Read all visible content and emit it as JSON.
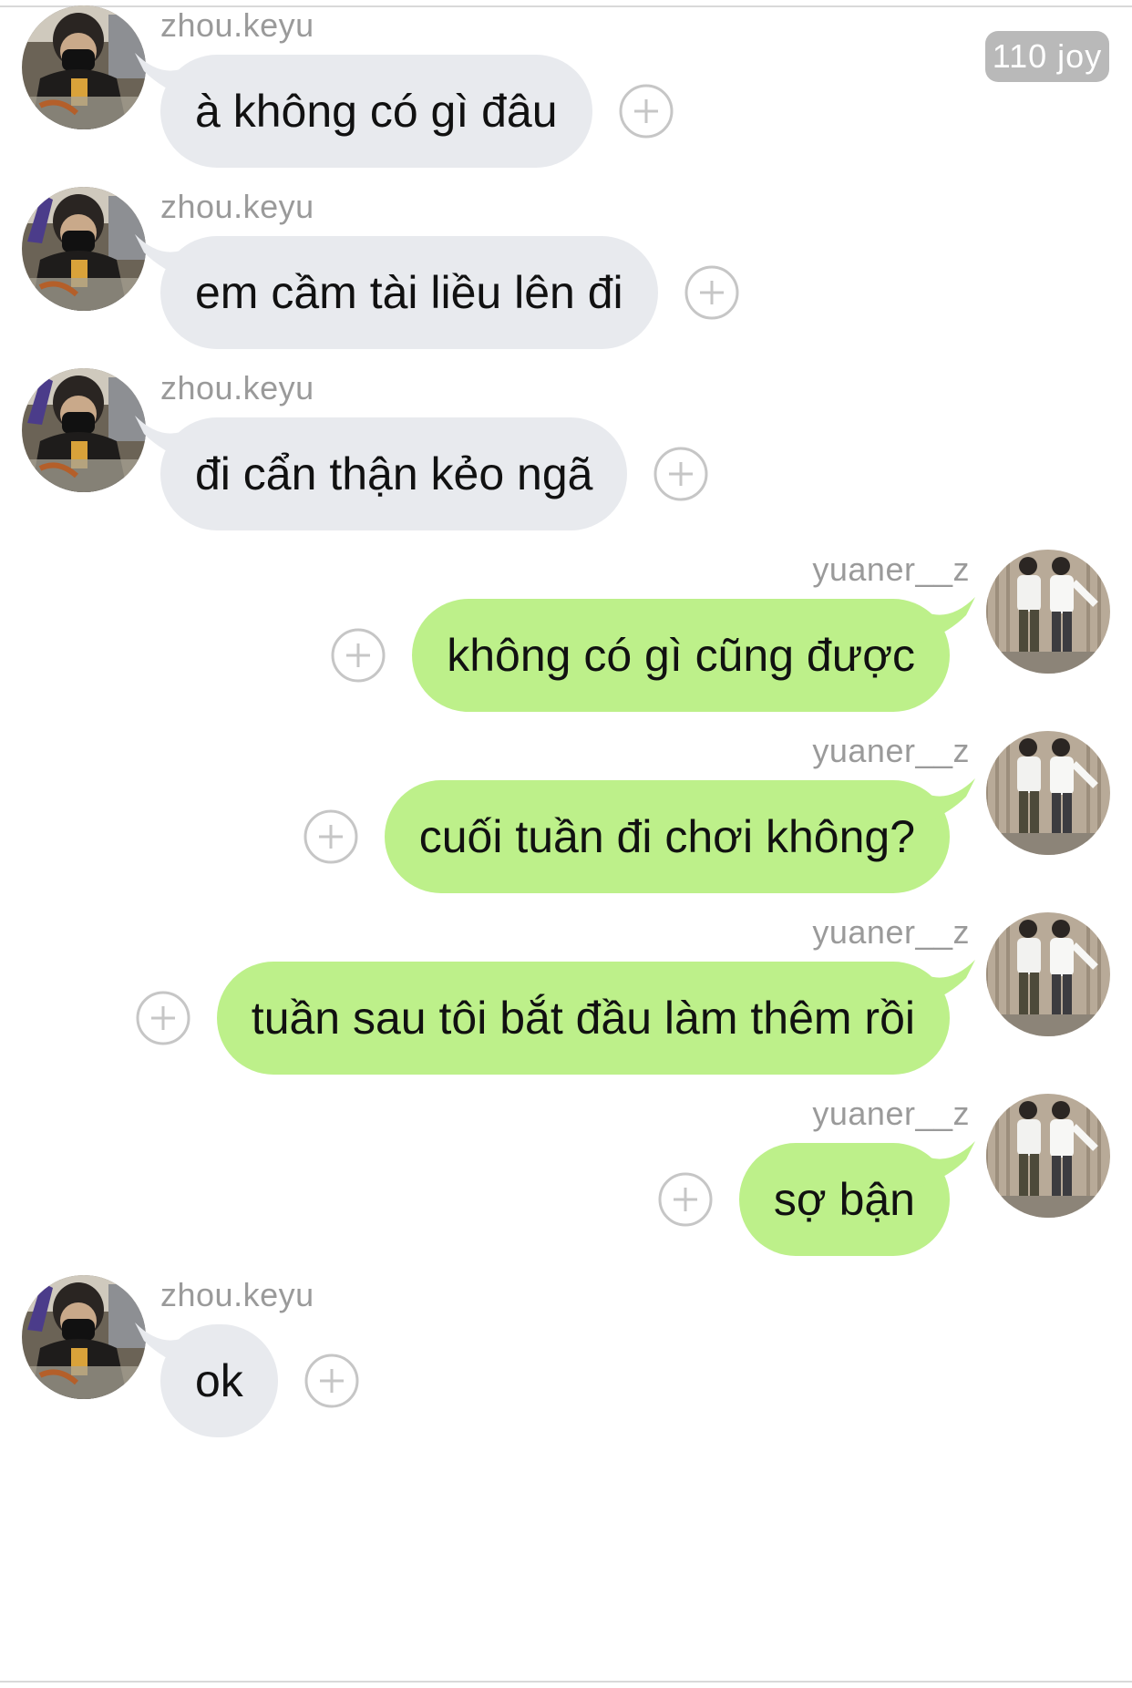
{
  "badge": "110 joy",
  "colors": {
    "incoming_bubble": "#e8eaee",
    "outgoing_bubble": "#bdf08a",
    "sender_text": "#9a9a9a",
    "badge_bg": "#b9b9b9"
  },
  "icons": {
    "add_reaction": "plus-circle-icon"
  },
  "messages": [
    {
      "direction": "in",
      "sender": "zhou.keyu",
      "text": "à không có gì đâu"
    },
    {
      "direction": "in",
      "sender": "zhou.keyu",
      "text": "em cầm tài liều lên đi"
    },
    {
      "direction": "in",
      "sender": "zhou.keyu",
      "text": "đi cẩn thận kẻo ngã"
    },
    {
      "direction": "out",
      "sender": "yuaner__z",
      "text": "không có gì cũng được"
    },
    {
      "direction": "out",
      "sender": "yuaner__z",
      "text": "cuối tuần đi chơi không?"
    },
    {
      "direction": "out",
      "sender": "yuaner__z",
      "text": "tuần sau tôi bắt đầu làm thêm rồi"
    },
    {
      "direction": "out",
      "sender": "yuaner__z",
      "text": "sợ bận"
    },
    {
      "direction": "in",
      "sender": "zhou.keyu",
      "text": "ok"
    }
  ]
}
